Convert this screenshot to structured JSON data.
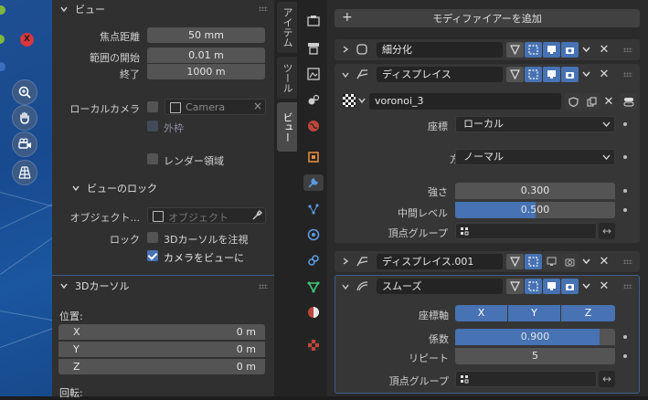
{
  "npanel": {
    "view_header": "ビュー",
    "focal_label": "焦点距離",
    "focal_value": "50 mm",
    "clip_start_label": "範囲の開始",
    "clip_start_value": "0.01 m",
    "clip_end_label": "終了",
    "clip_end_value": "1000 m",
    "local_camera_label": "ローカルカメラ",
    "camera_value": "Camera",
    "outline_label": "外枠",
    "render_region_label": "レンダー領域",
    "view_lock_header": "ビューのロック",
    "lock_object_label": "オブジェクト...",
    "lock_object_placeholder": "オブジェクト",
    "lock_label": "ロック",
    "lock_cursor_label": "3Dカーソルを注視",
    "camera_to_view_label": "カメラをビューに",
    "cursor_header": "3Dカーソル",
    "location_label": "位置:",
    "x_label": "X",
    "x_value": "0 m",
    "y_label": "Y",
    "y_value": "0 m",
    "z_label": "Z",
    "z_value": "0 m",
    "rotation_label": "回転:"
  },
  "vtabs": [
    "アイテム",
    "ツール",
    "ビュー"
  ],
  "modifiers": {
    "add_label": "モディファイアーを追加",
    "subdivision_name": "細分化",
    "displace_name": "ディスプレイス",
    "texture_name": "voronoi_3",
    "coords_label": "座標",
    "coords_value": "ローカル",
    "direction_label": "方向",
    "direction_value": "ノーマル",
    "strength_label": "強さ",
    "strength_value": "0.300",
    "midlevel_label": "中間レベル",
    "midlevel_value": "0.500",
    "midlevel_fraction": 0.5,
    "vgroup_label": "頂点グループ",
    "displace2_name": "ディスプレイス.001",
    "smooth_name": "スムーズ",
    "axis_label": "座標軸",
    "axis_x": "X",
    "axis_y": "Y",
    "axis_z": "Z",
    "factor_label": "係数",
    "factor_value": "0.900",
    "factor_fraction": 0.9,
    "repeat_label": "リピート",
    "repeat_value": "5",
    "vgroup2_label": "頂点グループ"
  },
  "colors": {
    "accent": "#4772b3",
    "panel": "#303030",
    "viewport": "#1f4f92"
  }
}
